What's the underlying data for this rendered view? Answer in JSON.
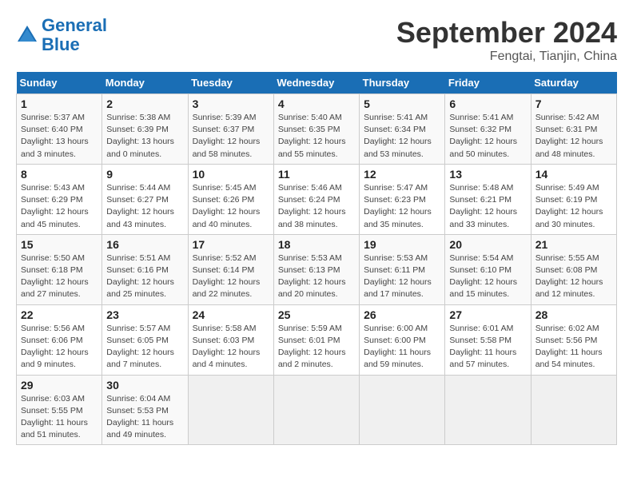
{
  "header": {
    "logo_line1": "General",
    "logo_line2": "Blue",
    "month": "September 2024",
    "location": "Fengtai, Tianjin, China"
  },
  "weekdays": [
    "Sunday",
    "Monday",
    "Tuesday",
    "Wednesday",
    "Thursday",
    "Friday",
    "Saturday"
  ],
  "weeks": [
    [
      {
        "day": "1",
        "info": "Sunrise: 5:37 AM\nSunset: 6:40 PM\nDaylight: 13 hours\nand 3 minutes."
      },
      {
        "day": "2",
        "info": "Sunrise: 5:38 AM\nSunset: 6:39 PM\nDaylight: 13 hours\nand 0 minutes."
      },
      {
        "day": "3",
        "info": "Sunrise: 5:39 AM\nSunset: 6:37 PM\nDaylight: 12 hours\nand 58 minutes."
      },
      {
        "day": "4",
        "info": "Sunrise: 5:40 AM\nSunset: 6:35 PM\nDaylight: 12 hours\nand 55 minutes."
      },
      {
        "day": "5",
        "info": "Sunrise: 5:41 AM\nSunset: 6:34 PM\nDaylight: 12 hours\nand 53 minutes."
      },
      {
        "day": "6",
        "info": "Sunrise: 5:41 AM\nSunset: 6:32 PM\nDaylight: 12 hours\nand 50 minutes."
      },
      {
        "day": "7",
        "info": "Sunrise: 5:42 AM\nSunset: 6:31 PM\nDaylight: 12 hours\nand 48 minutes."
      }
    ],
    [
      {
        "day": "8",
        "info": "Sunrise: 5:43 AM\nSunset: 6:29 PM\nDaylight: 12 hours\nand 45 minutes."
      },
      {
        "day": "9",
        "info": "Sunrise: 5:44 AM\nSunset: 6:27 PM\nDaylight: 12 hours\nand 43 minutes."
      },
      {
        "day": "10",
        "info": "Sunrise: 5:45 AM\nSunset: 6:26 PM\nDaylight: 12 hours\nand 40 minutes."
      },
      {
        "day": "11",
        "info": "Sunrise: 5:46 AM\nSunset: 6:24 PM\nDaylight: 12 hours\nand 38 minutes."
      },
      {
        "day": "12",
        "info": "Sunrise: 5:47 AM\nSunset: 6:23 PM\nDaylight: 12 hours\nand 35 minutes."
      },
      {
        "day": "13",
        "info": "Sunrise: 5:48 AM\nSunset: 6:21 PM\nDaylight: 12 hours\nand 33 minutes."
      },
      {
        "day": "14",
        "info": "Sunrise: 5:49 AM\nSunset: 6:19 PM\nDaylight: 12 hours\nand 30 minutes."
      }
    ],
    [
      {
        "day": "15",
        "info": "Sunrise: 5:50 AM\nSunset: 6:18 PM\nDaylight: 12 hours\nand 27 minutes."
      },
      {
        "day": "16",
        "info": "Sunrise: 5:51 AM\nSunset: 6:16 PM\nDaylight: 12 hours\nand 25 minutes."
      },
      {
        "day": "17",
        "info": "Sunrise: 5:52 AM\nSunset: 6:14 PM\nDaylight: 12 hours\nand 22 minutes."
      },
      {
        "day": "18",
        "info": "Sunrise: 5:53 AM\nSunset: 6:13 PM\nDaylight: 12 hours\nand 20 minutes."
      },
      {
        "day": "19",
        "info": "Sunrise: 5:53 AM\nSunset: 6:11 PM\nDaylight: 12 hours\nand 17 minutes."
      },
      {
        "day": "20",
        "info": "Sunrise: 5:54 AM\nSunset: 6:10 PM\nDaylight: 12 hours\nand 15 minutes."
      },
      {
        "day": "21",
        "info": "Sunrise: 5:55 AM\nSunset: 6:08 PM\nDaylight: 12 hours\nand 12 minutes."
      }
    ],
    [
      {
        "day": "22",
        "info": "Sunrise: 5:56 AM\nSunset: 6:06 PM\nDaylight: 12 hours\nand 9 minutes."
      },
      {
        "day": "23",
        "info": "Sunrise: 5:57 AM\nSunset: 6:05 PM\nDaylight: 12 hours\nand 7 minutes."
      },
      {
        "day": "24",
        "info": "Sunrise: 5:58 AM\nSunset: 6:03 PM\nDaylight: 12 hours\nand 4 minutes."
      },
      {
        "day": "25",
        "info": "Sunrise: 5:59 AM\nSunset: 6:01 PM\nDaylight: 12 hours\nand 2 minutes."
      },
      {
        "day": "26",
        "info": "Sunrise: 6:00 AM\nSunset: 6:00 PM\nDaylight: 11 hours\nand 59 minutes."
      },
      {
        "day": "27",
        "info": "Sunrise: 6:01 AM\nSunset: 5:58 PM\nDaylight: 11 hours\nand 57 minutes."
      },
      {
        "day": "28",
        "info": "Sunrise: 6:02 AM\nSunset: 5:56 PM\nDaylight: 11 hours\nand 54 minutes."
      }
    ],
    [
      {
        "day": "29",
        "info": "Sunrise: 6:03 AM\nSunset: 5:55 PM\nDaylight: 11 hours\nand 51 minutes."
      },
      {
        "day": "30",
        "info": "Sunrise: 6:04 AM\nSunset: 5:53 PM\nDaylight: 11 hours\nand 49 minutes."
      },
      {
        "day": "",
        "info": ""
      },
      {
        "day": "",
        "info": ""
      },
      {
        "day": "",
        "info": ""
      },
      {
        "day": "",
        "info": ""
      },
      {
        "day": "",
        "info": ""
      }
    ]
  ]
}
